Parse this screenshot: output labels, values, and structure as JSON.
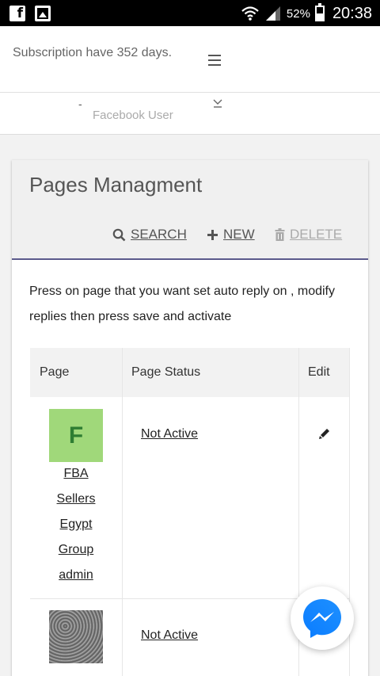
{
  "statusbar": {
    "battery_percent": "52%",
    "time": "20:38"
  },
  "header": {
    "subscription_text": "Subscription have 352 days."
  },
  "user": {
    "prefix": "-",
    "name": "Facebook User"
  },
  "card": {
    "title": "Pages Managment",
    "toolbar": {
      "search_label": "SEARCH",
      "new_label": "NEW",
      "delete_label": "DELETE"
    },
    "intro": "Press on page that you want set auto reply on , modify replies then press save and activate"
  },
  "table": {
    "headers": {
      "page": "Page",
      "status": "Page Status",
      "edit": "Edit"
    },
    "rows": [
      {
        "avatar_letter": "F",
        "name_lines": [
          "FBA",
          "Sellers",
          "Egypt",
          "Group",
          "admin"
        ],
        "status": "Not Active"
      },
      {
        "status": "Not Active"
      }
    ]
  },
  "colors": {
    "accent_line": "#5b5a8c",
    "avatar_green": "#a0d87a",
    "messenger_blue": "#1877f2"
  }
}
